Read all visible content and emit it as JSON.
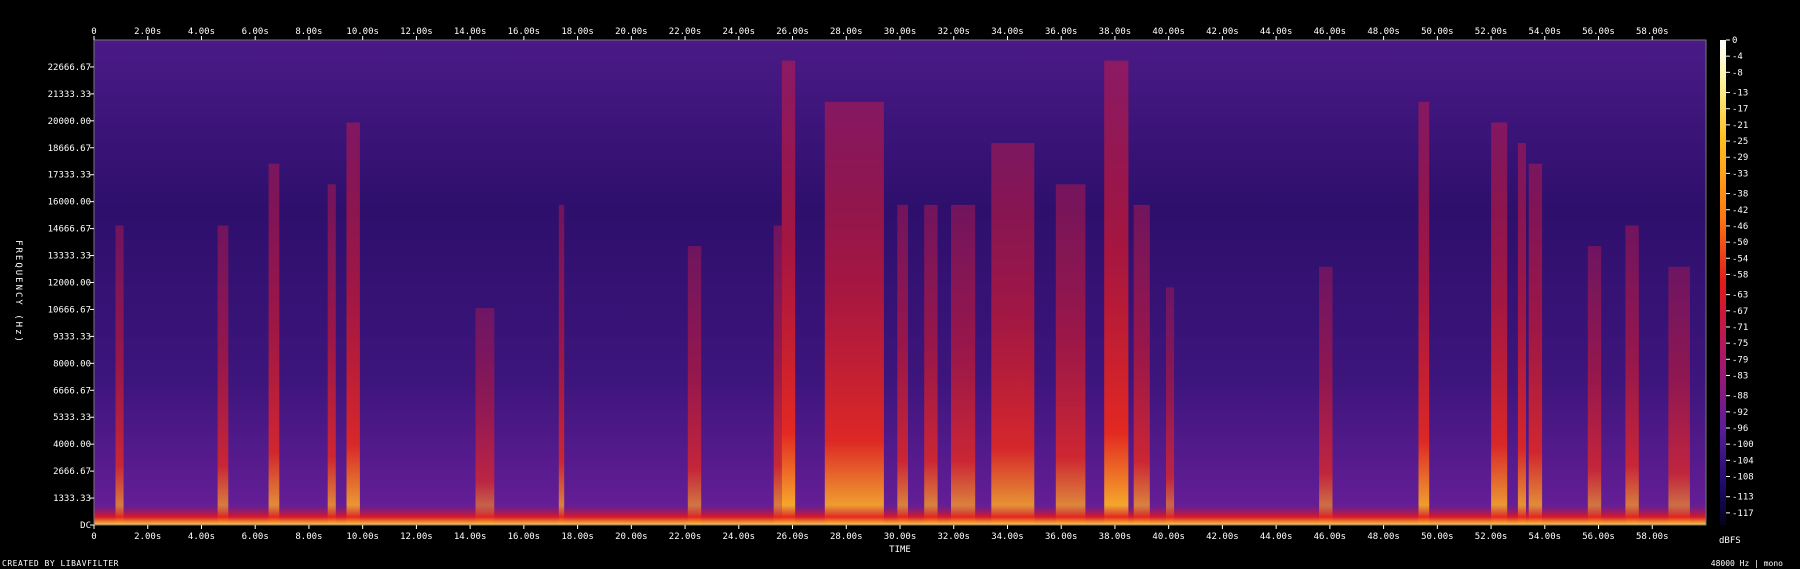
{
  "chart_data": {
    "type": "heatmap",
    "title": "",
    "xlabel": "TIME",
    "ylabel": "FREQUENCY (Hz)",
    "x_unit": "s",
    "xlim": [
      0,
      60
    ],
    "ylim": [
      0,
      24000
    ],
    "x_ticks": [
      0,
      2,
      4,
      6,
      8,
      10,
      12,
      14,
      16,
      18,
      20,
      22,
      24,
      26,
      28,
      30,
      32,
      34,
      36,
      38,
      40,
      42,
      44,
      46,
      48,
      50,
      52,
      54,
      56,
      58
    ],
    "x_tick_labels": [
      "0",
      "2.00s",
      "4.00s",
      "6.00s",
      "8.00s",
      "10.00s",
      "12.00s",
      "14.00s",
      "16.00s",
      "18.00s",
      "20.00s",
      "22.00s",
      "24.00s",
      "26.00s",
      "28.00s",
      "30.00s",
      "32.00s",
      "34.00s",
      "36.00s",
      "38.00s",
      "40.00s",
      "42.00s",
      "44.00s",
      "46.00s",
      "48.00s",
      "50.00s",
      "52.00s",
      "54.00s",
      "56.00s",
      "58.00s"
    ],
    "y_ticks": [
      0,
      1333.33,
      2666.67,
      4000,
      5333.33,
      6666.67,
      8000,
      9333.33,
      10666.67,
      12000,
      13333.33,
      14666.67,
      16000,
      17333.33,
      18666.67,
      20000,
      21333.33,
      22666.67
    ],
    "y_tick_labels": [
      "DC",
      "1333.33",
      "2666.67",
      "4000.00",
      "5333.33",
      "6666.67",
      "8000.00",
      "9333.33",
      "10666.67",
      "12000.00",
      "13333.33",
      "14666.67",
      "16000.00",
      "17333.33",
      "18666.67",
      "20000.00",
      "21333.33",
      "22666.67"
    ],
    "colorbar": {
      "label": "dBFS",
      "range": [
        -120,
        0
      ],
      "ticks": [
        0,
        -4,
        -8,
        -13,
        -17,
        -21,
        -25,
        -29,
        -33,
        -38,
        -42,
        -46,
        -50,
        -54,
        -58,
        -63,
        -67,
        -71,
        -75,
        -79,
        -83,
        -88,
        -92,
        -96,
        -100,
        -104,
        -108,
        -113,
        -117
      ],
      "tick_labels": [
        "0",
        "-4",
        "-8",
        "-13",
        "-17",
        "-21",
        "-25",
        "-29",
        "-33",
        "-38",
        "-42",
        "-46",
        "-50",
        "-54",
        "-58",
        "-63",
        "-67",
        "-71",
        "-75",
        "-79",
        "-83",
        "-88",
        "-92",
        "-96",
        "-100",
        "-104",
        "-108",
        "-113",
        "-117"
      ]
    },
    "colors": {
      "low": "#0c0330",
      "mid": "#6a1f9a",
      "high_mid": "#e3191b",
      "high": "#ffe62c",
      "peak": "#ffffff"
    },
    "bursts": [
      {
        "start": 0.8,
        "end": 1.1,
        "level": 0.55
      },
      {
        "start": 4.6,
        "end": 5.0,
        "level": 0.55
      },
      {
        "start": 6.5,
        "end": 6.9,
        "level": 0.7
      },
      {
        "start": 8.7,
        "end": 9.0,
        "level": 0.65
      },
      {
        "start": 9.4,
        "end": 9.9,
        "level": 0.8
      },
      {
        "start": 14.2,
        "end": 14.9,
        "level": 0.35
      },
      {
        "start": 17.3,
        "end": 17.5,
        "level": 0.6
      },
      {
        "start": 22.1,
        "end": 22.6,
        "level": 0.5
      },
      {
        "start": 25.3,
        "end": 25.6,
        "level": 0.55
      },
      {
        "start": 25.6,
        "end": 26.1,
        "level": 0.95
      },
      {
        "start": 27.2,
        "end": 29.4,
        "level": 0.85
      },
      {
        "start": 29.9,
        "end": 30.3,
        "level": 0.6
      },
      {
        "start": 30.9,
        "end": 31.4,
        "level": 0.6
      },
      {
        "start": 31.9,
        "end": 32.8,
        "level": 0.6
      },
      {
        "start": 33.4,
        "end": 35.0,
        "level": 0.75
      },
      {
        "start": 35.8,
        "end": 36.9,
        "level": 0.65
      },
      {
        "start": 37.6,
        "end": 38.5,
        "level": 0.95
      },
      {
        "start": 38.7,
        "end": 39.3,
        "level": 0.6
      },
      {
        "start": 39.9,
        "end": 40.2,
        "level": 0.4
      },
      {
        "start": 45.6,
        "end": 46.1,
        "level": 0.45
      },
      {
        "start": 49.3,
        "end": 49.7,
        "level": 0.85
      },
      {
        "start": 52.0,
        "end": 52.6,
        "level": 0.8
      },
      {
        "start": 53.0,
        "end": 53.3,
        "level": 0.75
      },
      {
        "start": 53.4,
        "end": 53.9,
        "level": 0.7
      },
      {
        "start": 55.6,
        "end": 56.1,
        "level": 0.5
      },
      {
        "start": 57.0,
        "end": 57.5,
        "level": 0.55
      },
      {
        "start": 58.6,
        "end": 59.4,
        "level": 0.45
      }
    ]
  },
  "footer": {
    "credit": "CREATED BY LIBAVFILTER",
    "stream_info": "48000 Hz | mono"
  }
}
